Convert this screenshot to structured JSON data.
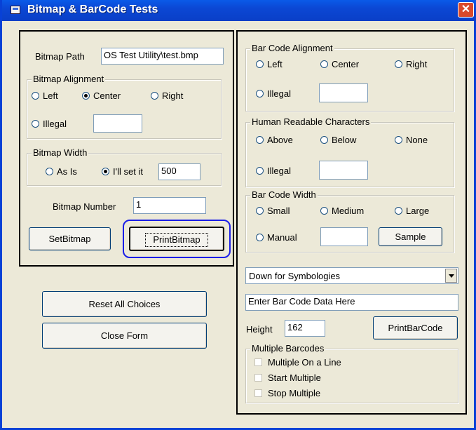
{
  "window": {
    "title": "Bitmap & BarCode Tests",
    "close_glyph": "✕"
  },
  "bitmap": {
    "path_label": "Bitmap Path",
    "path_value": "OS Test Utility\\test.bmp",
    "alignment": {
      "legend": "Bitmap Alignment",
      "left": "Left",
      "center": "Center",
      "right": "Right",
      "illegal": "Illegal",
      "illegal_value": "",
      "selected": "Center"
    },
    "width": {
      "legend": "Bitmap Width",
      "as_is": "As Is",
      "set_it": "I'll set it",
      "value": "500",
      "selected": "I'll set it"
    },
    "number_label": "Bitmap Number",
    "number_value": "1",
    "set_button": "SetBitmap",
    "print_button": "PrintBitmap"
  },
  "actions": {
    "reset": "Reset All Choices",
    "close": "Close Form"
  },
  "barcode": {
    "alignment": {
      "legend": "Bar Code Alignment",
      "left": "Left",
      "center": "Center",
      "right": "Right",
      "illegal": "Illegal",
      "illegal_value": ""
    },
    "hri": {
      "legend": "Human Readable Characters",
      "above": "Above",
      "below": "Below",
      "none": "None",
      "illegal": "Illegal",
      "illegal_value": ""
    },
    "width": {
      "legend": "Bar Code Width",
      "small": "Small",
      "medium": "Medium",
      "large": "Large",
      "manual": "Manual",
      "manual_value": "",
      "sample_button": "Sample"
    },
    "symbology_select": "Down for Symbologies",
    "data_input": "Enter Bar Code Data Here",
    "height_label": "Height",
    "height_value": "162",
    "print_button": "PrintBarCode",
    "multiple": {
      "legend": "Multiple Barcodes",
      "on_line": "Multiple On a Line",
      "start": "Start Multiple",
      "stop": "Stop Multiple"
    }
  },
  "colors": {
    "title_bar": "#0b47d4",
    "face": "#ece9d8",
    "focus_ring": "#1a1ee8",
    "close": "#d9492b"
  }
}
